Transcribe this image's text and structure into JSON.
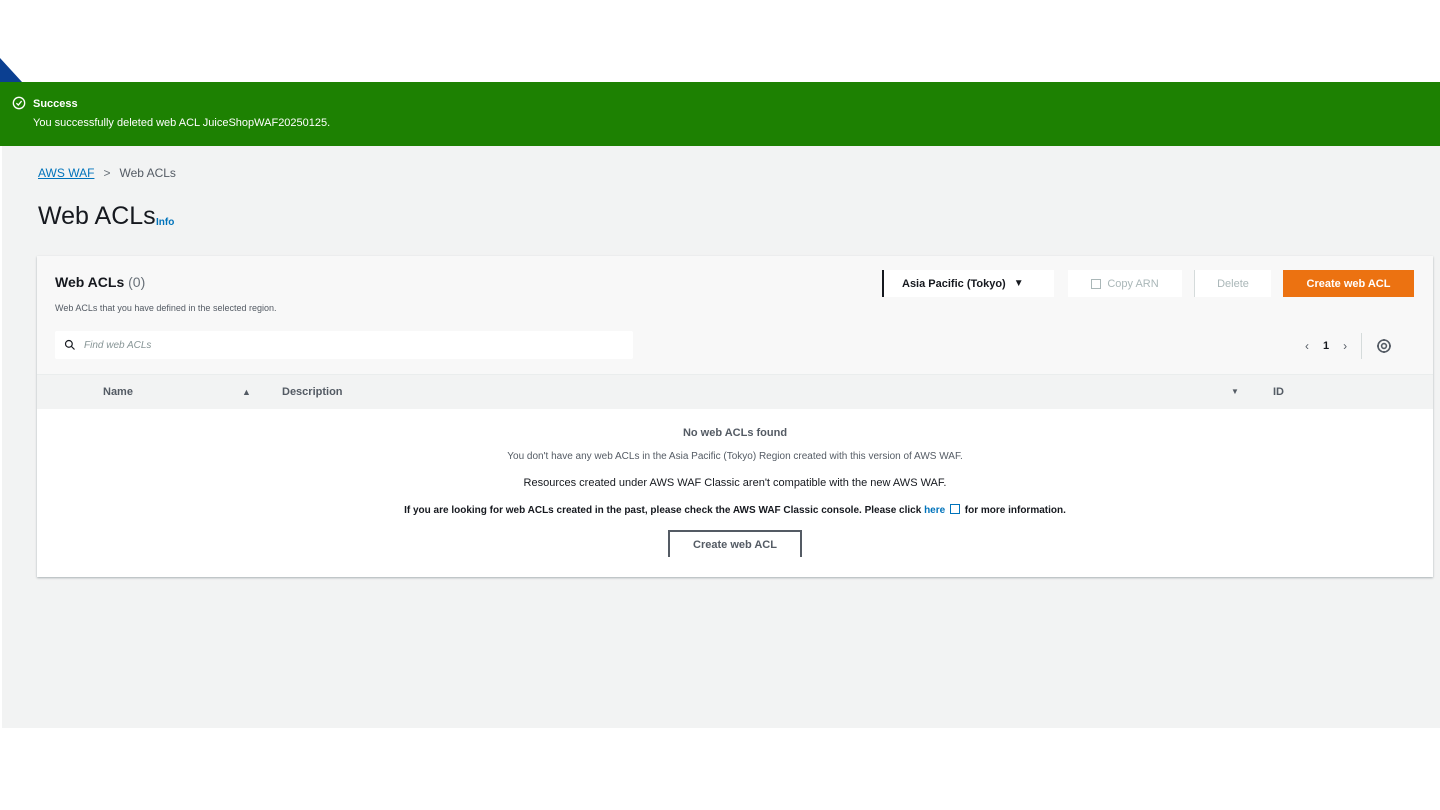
{
  "flash": {
    "title": "Success",
    "message": "You successfully deleted web ACL JuiceShopWAF20250125."
  },
  "breadcrumb": {
    "root": "AWS WAF",
    "separator": ">",
    "current": "Web ACLs"
  },
  "page": {
    "title": "Web ACLs",
    "info": "Info"
  },
  "panel": {
    "title": "Web ACLs",
    "count": "(0)",
    "description": "Web ACLs that you have defined in the selected region.",
    "region": "Asia Pacific (Tokyo)",
    "region_caret": "▼",
    "copy_arn": "Copy ARN",
    "delete": "Delete",
    "create": "Create web ACL",
    "search_placeholder": "Find web ACLs",
    "pagination": {
      "prev": "‹",
      "page": "1",
      "next": "›"
    }
  },
  "table": {
    "columns": [
      {
        "label": "Name",
        "sort": "▲"
      },
      {
        "label": "Description",
        "sort": "▼"
      },
      {
        "label": "ID"
      }
    ]
  },
  "empty": {
    "title": "No web ACLs found",
    "line1": "You don't have any web ACLs in the Asia Pacific (Tokyo) Region created with this version of AWS WAF.",
    "line2": "Resources created under AWS WAF Classic aren't compatible with the new AWS WAF.",
    "line3_pre": "If you are looking for web ACLs created in the past, please check the AWS WAF Classic console. Please click ",
    "line3_link": "here",
    "line3_post": " for more information.",
    "button": "Create web ACL"
  },
  "colors": {
    "success": "#1d8102",
    "primary_button": "#ec7211",
    "link": "#0073bb"
  }
}
